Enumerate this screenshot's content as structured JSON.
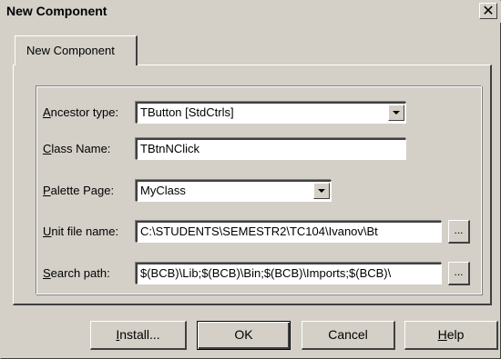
{
  "window": {
    "title": "New Component",
    "close_glyph": "✕"
  },
  "tab": {
    "label": "New Component"
  },
  "form": {
    "ancestor": {
      "label_first": "A",
      "label_rest": "ncestor type:",
      "value": "TButton  [StdCtrls]"
    },
    "class_name": {
      "label_first": "C",
      "label_rest": "lass Name:",
      "value": "TBtnNClick"
    },
    "palette": {
      "label_first": "P",
      "label_rest": "alette Page:",
      "value": "MyClass"
    },
    "unit": {
      "label_first": "U",
      "label_rest": "nit file name:",
      "value": "C:\\STUDENTS\\SEMESTR2\\TC104\\Ivanov\\Bt"
    },
    "search": {
      "label_first": "S",
      "label_rest": "earch path:",
      "value": "$(BCB)\\Lib;$(BCB)\\Bin;$(BCB)\\Imports;$(BCB)\\"
    },
    "ellipsis": "..."
  },
  "buttons": {
    "install": {
      "first": "I",
      "rest": "nstall..."
    },
    "ok": "OK",
    "cancel": "Cancel",
    "help": {
      "first": "H",
      "rest": "elp"
    }
  },
  "icons": {
    "dropdown": "chevron-down-icon"
  }
}
